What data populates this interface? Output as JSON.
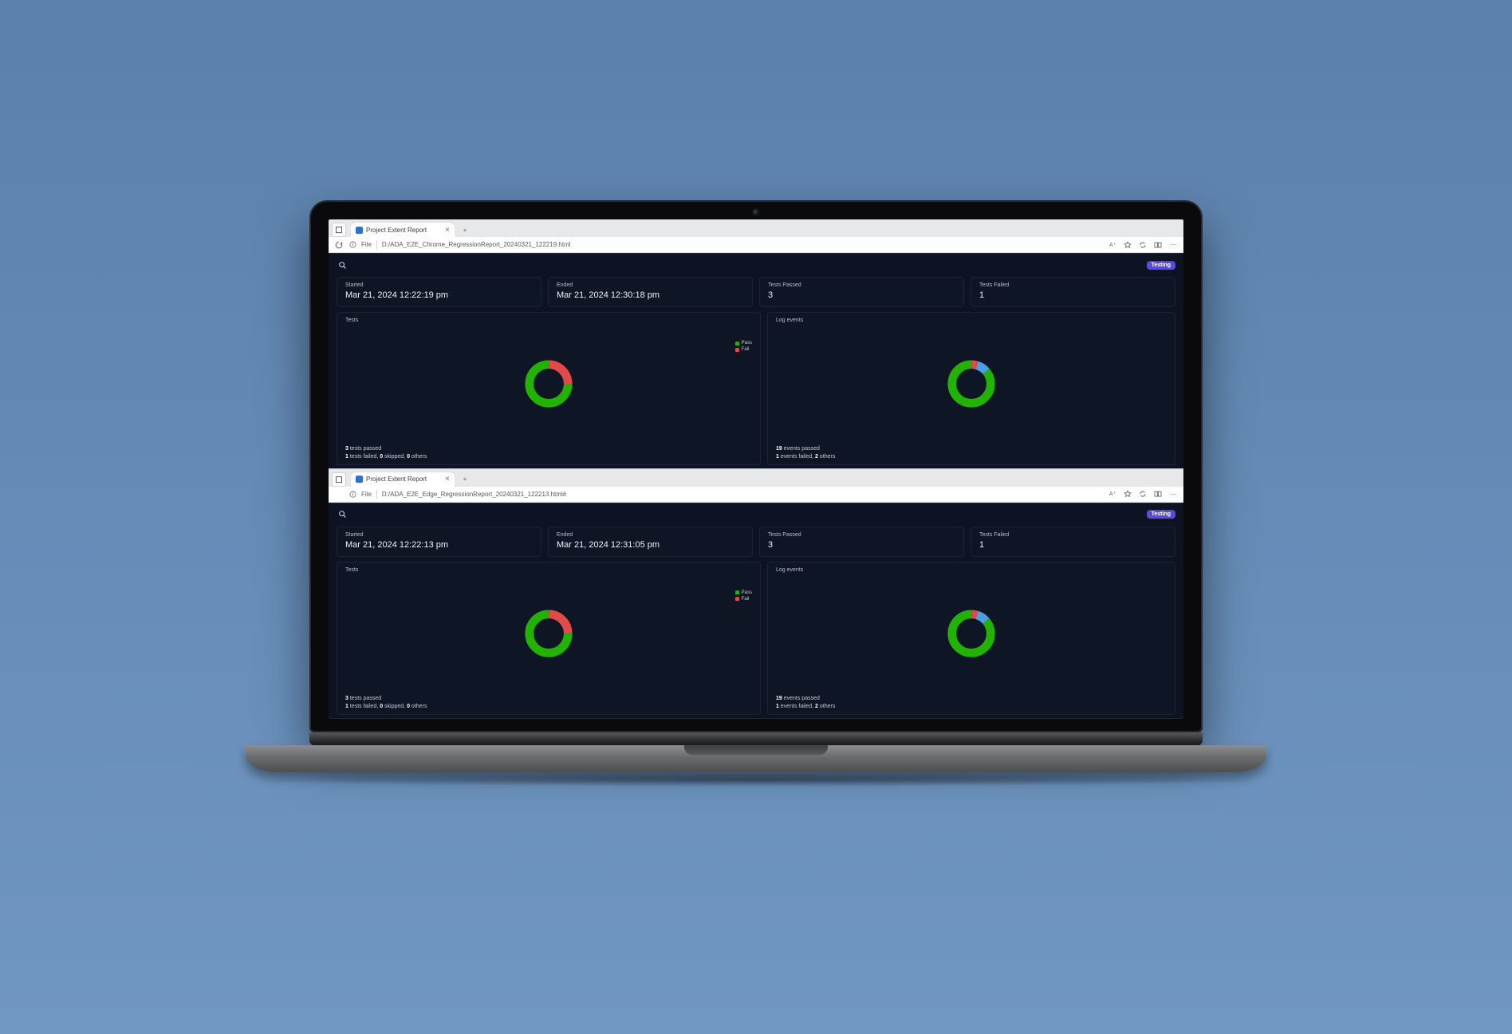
{
  "windows": [
    {
      "tab_title": "Project Extent Report",
      "file_label": "File",
      "url": "D:/ADA_E2E_Chrome_RegressionReport_20240321_122219.html",
      "badge": "Testing",
      "stats": {
        "started_label": "Started",
        "started_value": "Mar 21, 2024 12:22:19 pm",
        "ended_label": "Ended",
        "ended_value": "Mar 21, 2024 12:30:18 pm",
        "passed_label": "Tests Passed",
        "passed_value": "3",
        "failed_label": "Tests Failed",
        "failed_value": "1"
      },
      "tests_card": {
        "title": "Tests",
        "footer1_pre": "3",
        "footer1_post": " tests passed",
        "footer2_a": "1",
        "footer2_a_txt": " tests failed, ",
        "footer2_b": "0",
        "footer2_b_txt": " skipped, ",
        "footer2_c": "0",
        "footer2_c_txt": " others",
        "legend_pass": "Pass",
        "legend_fail": "Fail"
      },
      "log_card": {
        "title": "Log events",
        "footer1_pre": "19",
        "footer1_post": " events passed",
        "footer2_a": "1",
        "footer2_a_txt": " events failed, ",
        "footer2_b": "2",
        "footer2_b_txt": " others"
      }
    },
    {
      "tab_title": "Project Extent Report",
      "file_label": "File",
      "url": "D:/ADA_E2E_Edge_RegressionReport_20240321_122213.html#",
      "badge": "Testing",
      "stats": {
        "started_label": "Started",
        "started_value": "Mar 21, 2024 12:22:13 pm",
        "ended_label": "Ended",
        "ended_value": "Mar 21, 2024 12:31:05 pm",
        "passed_label": "Tests Passed",
        "passed_value": "3",
        "failed_label": "Tests Failed",
        "failed_value": "1"
      },
      "tests_card": {
        "title": "Tests",
        "footer1_pre": "3",
        "footer1_post": " tests passed",
        "footer2_a": "1",
        "footer2_a_txt": " tests failed, ",
        "footer2_b": "0",
        "footer2_b_txt": " skipped, ",
        "footer2_c": "0",
        "footer2_c_txt": " others",
        "legend_pass": "Pass",
        "legend_fail": "Fail"
      },
      "log_card": {
        "title": "Log events",
        "footer1_pre": "19",
        "footer1_post": " events passed",
        "footer2_a": "1",
        "footer2_a_txt": " events failed, ",
        "footer2_b": "2",
        "footer2_b_txt": " others"
      }
    }
  ],
  "colors": {
    "pass": "#22b300",
    "fail": "#e24a4a",
    "other": "#4aa0e2",
    "card_border": "#1c2437",
    "dark_bg": "#0d1322",
    "badge": "#5b4ad6"
  },
  "chart_data": [
    {
      "type": "pie",
      "title": "Tests",
      "series": [
        {
          "name": "Pass",
          "value": 3,
          "color": "#22b300"
        },
        {
          "name": "Fail",
          "value": 1,
          "color": "#e24a4a"
        }
      ]
    },
    {
      "type": "pie",
      "title": "Log events",
      "series": [
        {
          "name": "Pass",
          "value": 19,
          "color": "#22b300"
        },
        {
          "name": "Fail",
          "value": 1,
          "color": "#e24a4a"
        },
        {
          "name": "Other",
          "value": 2,
          "color": "#4aa0e2"
        }
      ]
    },
    {
      "type": "pie",
      "title": "Tests",
      "series": [
        {
          "name": "Pass",
          "value": 3,
          "color": "#22b300"
        },
        {
          "name": "Fail",
          "value": 1,
          "color": "#e24a4a"
        }
      ]
    },
    {
      "type": "pie",
      "title": "Log events",
      "series": [
        {
          "name": "Pass",
          "value": 19,
          "color": "#22b300"
        },
        {
          "name": "Fail",
          "value": 1,
          "color": "#e24a4a"
        },
        {
          "name": "Other",
          "value": 2,
          "color": "#4aa0e2"
        }
      ]
    }
  ]
}
